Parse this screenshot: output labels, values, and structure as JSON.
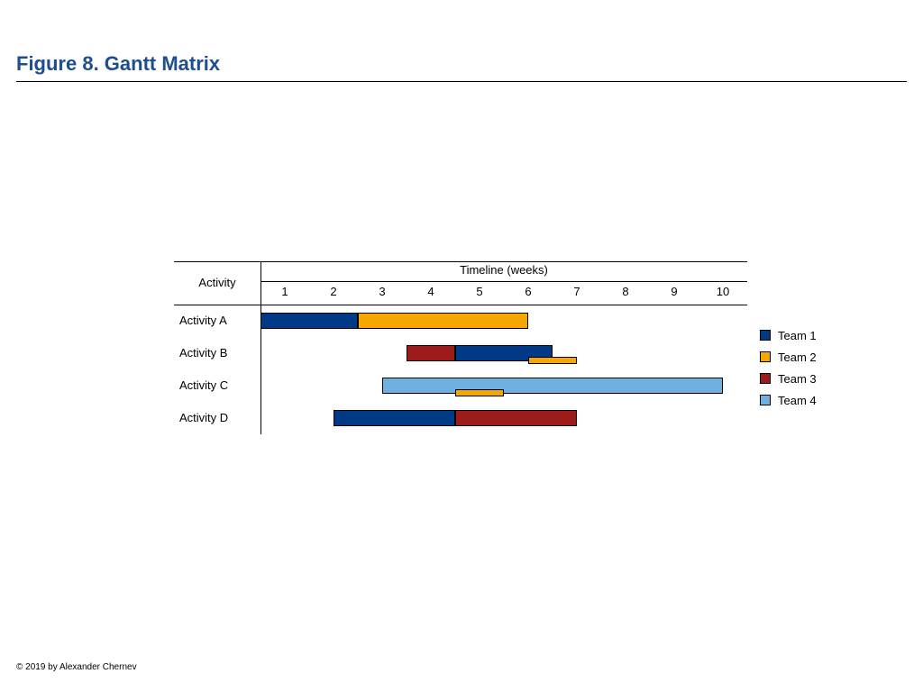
{
  "title": "Figure 8. Gantt Matrix",
  "footer": "© 2019 by Alexander Chernev",
  "headers": {
    "activity": "Activity",
    "timeline": "Timeline (weeks)"
  },
  "weeks": [
    "1",
    "2",
    "3",
    "4",
    "5",
    "6",
    "7",
    "8",
    "9",
    "10"
  ],
  "activities": [
    "Activity A",
    "Activity B",
    "Activity C",
    "Activity D"
  ],
  "legend": [
    {
      "name": "Team 1",
      "color": "#003a87"
    },
    {
      "name": "Team 2",
      "color": "#f5a600"
    },
    {
      "name": "Team 3",
      "color": "#9b1a1a"
    },
    {
      "name": "Team 4",
      "color": "#6fb0e0"
    }
  ],
  "chart_data": {
    "type": "bar",
    "title": "Figure 8. Gantt Matrix",
    "xlabel": "Timeline (weeks)",
    "ylabel": "Activity",
    "categories": [
      "Activity A",
      "Activity B",
      "Activity C",
      "Activity D"
    ],
    "x": [
      1,
      2,
      3,
      4,
      5,
      6,
      7,
      8,
      9,
      10
    ],
    "xlim": [
      1,
      10
    ],
    "series": [
      {
        "name": "Team 1",
        "color": "#003a87",
        "bars": [
          {
            "activity": "Activity A",
            "start": 1.0,
            "end": 3.0,
            "layer": "main"
          },
          {
            "activity": "Activity B",
            "start": 5.0,
            "end": 7.0,
            "layer": "main"
          },
          {
            "activity": "Activity D",
            "start": 2.5,
            "end": 5.0,
            "layer": "main"
          }
        ]
      },
      {
        "name": "Team 2",
        "color": "#f5a600",
        "bars": [
          {
            "activity": "Activity A",
            "start": 3.0,
            "end": 6.5,
            "layer": "main"
          },
          {
            "activity": "Activity B",
            "start": 6.5,
            "end": 7.5,
            "layer": "sub"
          },
          {
            "activity": "Activity C",
            "start": 5.0,
            "end": 6.0,
            "layer": "sub"
          }
        ]
      },
      {
        "name": "Team 3",
        "color": "#9b1a1a",
        "bars": [
          {
            "activity": "Activity B",
            "start": 4.0,
            "end": 5.0,
            "layer": "main"
          },
          {
            "activity": "Activity D",
            "start": 5.0,
            "end": 7.5,
            "layer": "main"
          }
        ]
      },
      {
        "name": "Team 4",
        "color": "#6fb0e0",
        "bars": [
          {
            "activity": "Activity C",
            "start": 3.5,
            "end": 10.5,
            "layer": "main"
          }
        ]
      }
    ]
  }
}
